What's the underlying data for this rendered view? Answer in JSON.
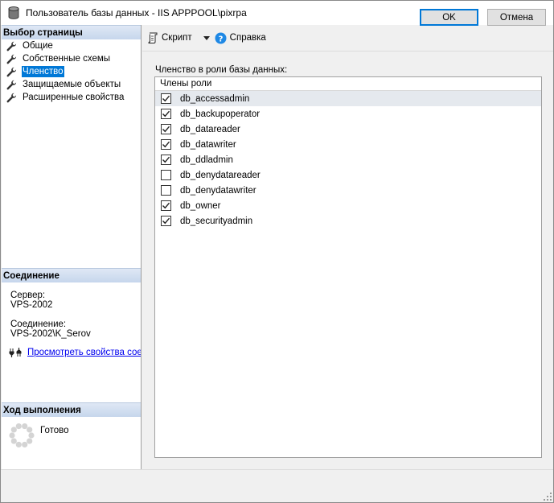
{
  "window": {
    "title": "Пользователь базы данных - IIS APPPOOL\\pixrpa"
  },
  "left": {
    "select_page_header": "Выбор страницы",
    "nav_items": [
      {
        "label": "Общие",
        "selected": false
      },
      {
        "label": "Собственные схемы",
        "selected": false
      },
      {
        "label": "Членство",
        "selected": true
      },
      {
        "label": "Защищаемые объекты",
        "selected": false
      },
      {
        "label": "Расширенные свойства",
        "selected": false
      }
    ],
    "connection_header": "Соединение",
    "server_label": "Сервер:",
    "server_value": "VPS-2002",
    "connection_label": "Соединение:",
    "connection_value": "VPS-2002\\K_Serov",
    "view_props_link": "Просмотреть свойства соед",
    "progress_header": "Ход выполнения",
    "progress_status": "Готово"
  },
  "toolbar": {
    "script_label": "Скрипт",
    "help_label": "Справка"
  },
  "membership": {
    "group_label": "Членство в роли базы данных:",
    "column_header": "Члены роли",
    "roles": [
      {
        "name": "db_accessadmin",
        "checked": true
      },
      {
        "name": "db_backupoperator",
        "checked": true
      },
      {
        "name": "db_datareader",
        "checked": true
      },
      {
        "name": "db_datawriter",
        "checked": true
      },
      {
        "name": "db_ddladmin",
        "checked": true
      },
      {
        "name": "db_denydatareader",
        "checked": false
      },
      {
        "name": "db_denydatawriter",
        "checked": false
      },
      {
        "name": "db_owner",
        "checked": true
      },
      {
        "name": "db_securityadmin",
        "checked": true
      }
    ]
  },
  "buttons": {
    "ok_label": "OK",
    "cancel_label": "Отмена"
  },
  "colors": {
    "selection": "#0078d7",
    "header_gradient_top": "#dfe8f5",
    "header_gradient_bottom": "#c6d6ec",
    "link": "#0000ee"
  }
}
